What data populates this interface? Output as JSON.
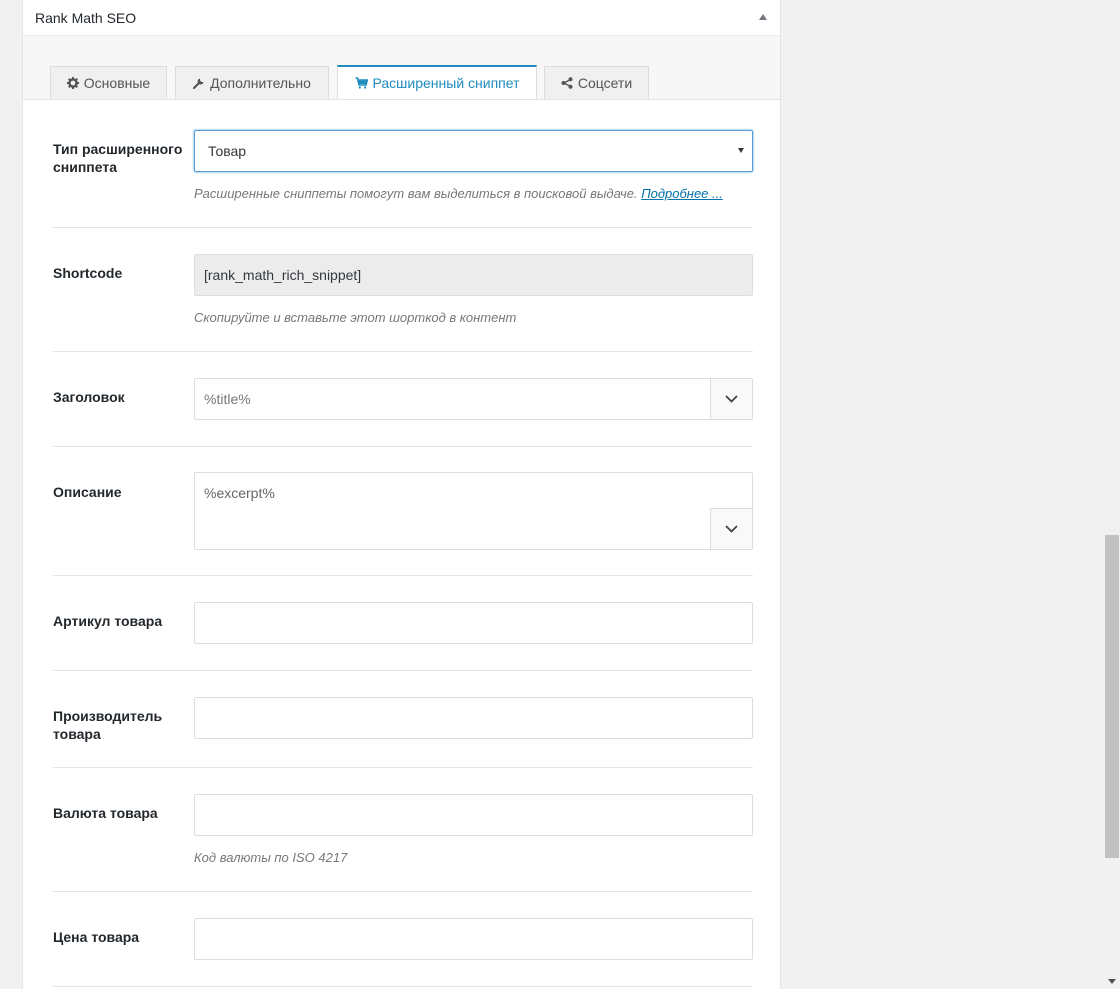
{
  "metabox": {
    "title": "Rank Math SEO"
  },
  "tabs": [
    {
      "label": "Основные",
      "icon": "gear-icon"
    },
    {
      "label": "Дополнительно",
      "icon": "wrench-icon"
    },
    {
      "label": "Расширенный сниппет",
      "icon": "cart-icon",
      "active": true
    },
    {
      "label": "Соцсети",
      "icon": "share-icon"
    }
  ],
  "fields": {
    "snippet_type": {
      "label": "Тип расширенного сниппета",
      "value": "Товар",
      "help": "Расширенные сниппеты помогут вам выделиться в поисковой выдаче.",
      "help_link": "Подробнее ..."
    },
    "shortcode": {
      "label": "Shortcode",
      "value": "[rank_math_rich_snippet]",
      "help": "Скопируйте и вставьте этот шорткод в контент"
    },
    "title": {
      "label": "Заголовок",
      "value": "%title%"
    },
    "description": {
      "label": "Описание",
      "value": "%excerpt%"
    },
    "sku": {
      "label": "Артикул товара",
      "value": ""
    },
    "brand": {
      "label": "Производитель товара",
      "value": ""
    },
    "currency": {
      "label": "Валюта товара",
      "value": "",
      "help": "Код валюты по ISO 4217"
    },
    "price": {
      "label": "Цена товара",
      "value": ""
    }
  },
  "colors": {
    "accent": "#1e8cbe",
    "link": "#0073aa",
    "label": "#23282d",
    "help": "#777777"
  }
}
